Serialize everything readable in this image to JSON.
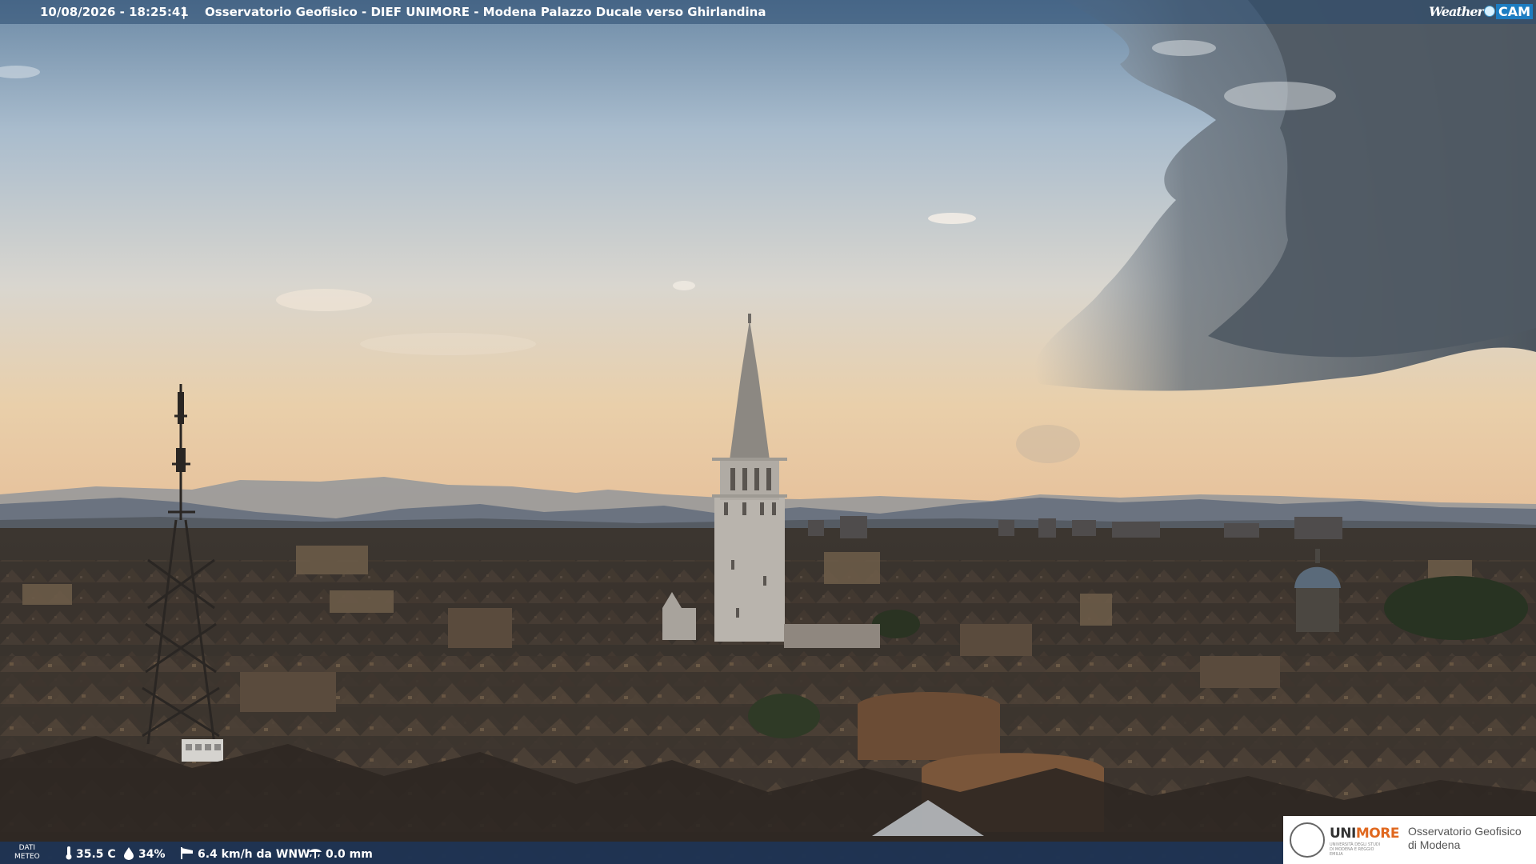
{
  "overlay": {
    "timestamp": "10/08/2026 - 18:25:41",
    "separator": "|",
    "title": "Osservatorio Geofisico - DIEF UNIMORE - Modena Palazzo Ducale verso Ghirlandina",
    "brand_weather": "Weather",
    "brand_cam": "CAM"
  },
  "weather": {
    "label_line1": "DATI",
    "label_line2": "METEO",
    "temperature": "35.5 C",
    "humidity": "34%",
    "wind": "6.4 km/h da WNW",
    "rain": "0.0 mm",
    "icons": [
      "thermometer-icon",
      "humidity-drop-icon",
      "wind-sock-icon",
      "rain-gauge-icon"
    ]
  },
  "logo": {
    "uni_part1": "UNI",
    "uni_part2": "MORE",
    "uni_small": "UNIVERSITÀ DEGLI STUDI DI MODENA E REGGIO EMILIA",
    "obs_line1": "Osservatorio Geofisico",
    "obs_line2": "di Modena"
  },
  "colors": {
    "accent_orange": "#e0681f",
    "brand_blue": "#1d7dc2",
    "sky_top": "#6f8ea8",
    "sky_horizon": "#e4c8a2",
    "storm_cloud": "#56606a"
  }
}
